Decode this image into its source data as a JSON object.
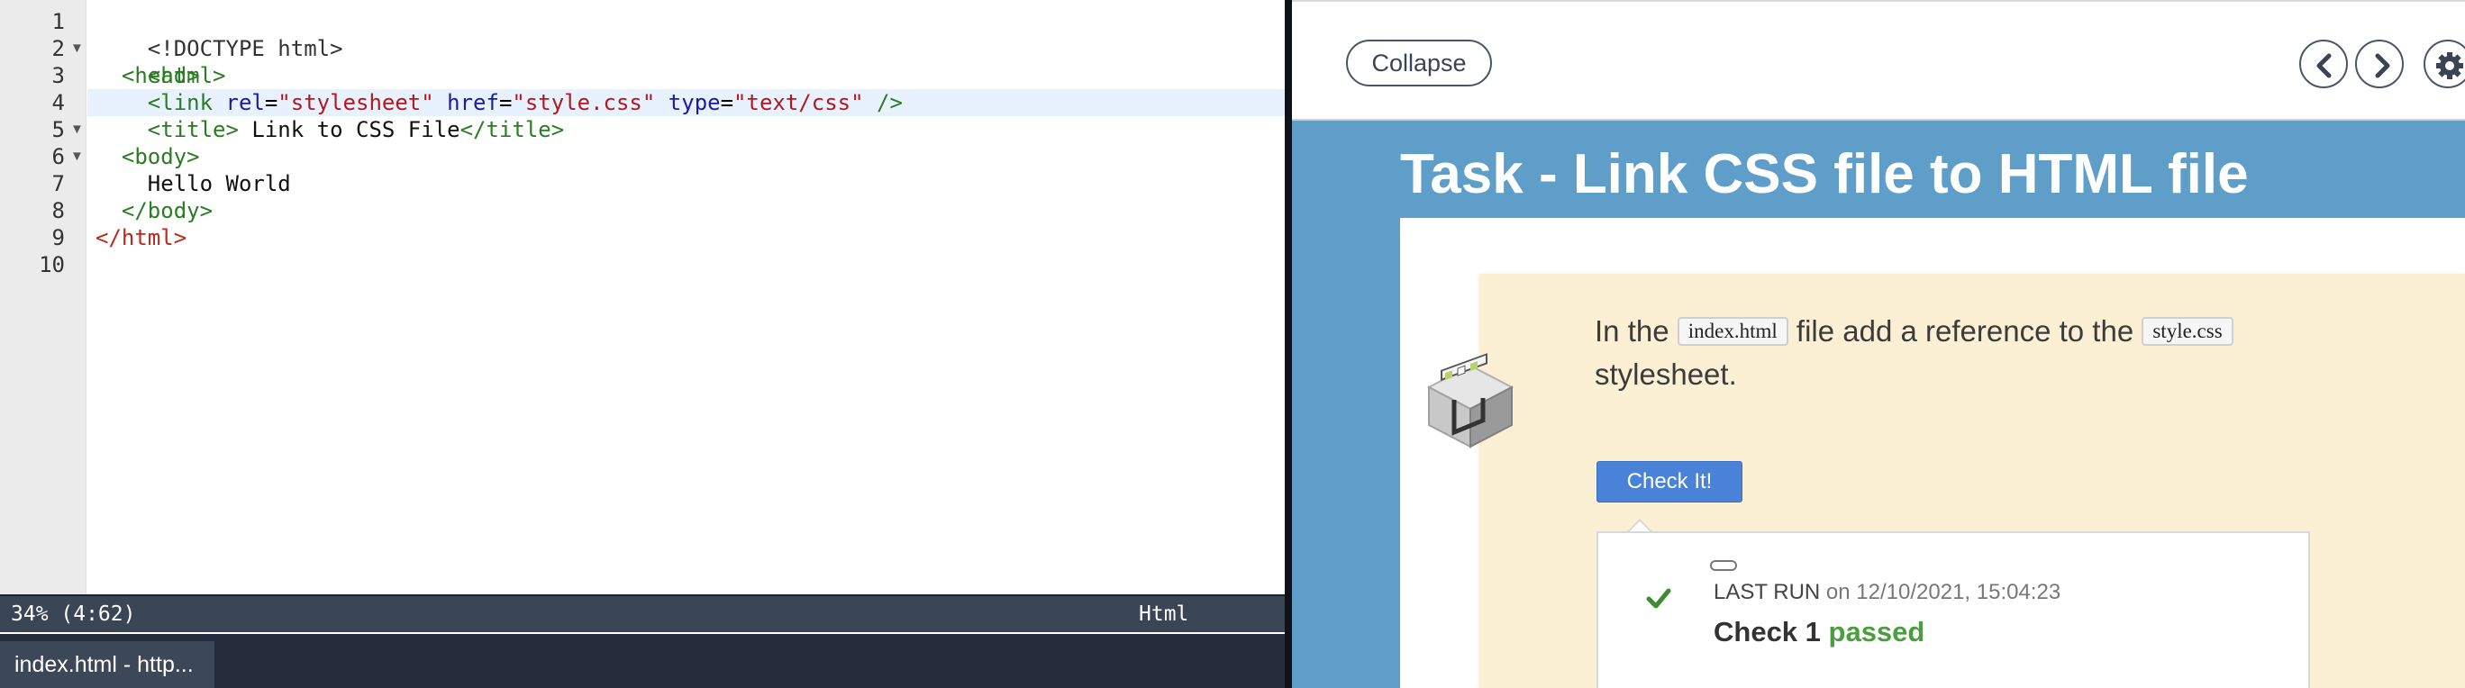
{
  "editor": {
    "line_numbers": [
      "1",
      "2",
      "3",
      "4",
      "5",
      "6",
      "7",
      "8",
      "9",
      "10"
    ],
    "fold_markers": {
      "line2": "▼",
      "line5": "▼",
      "line6": "▼"
    },
    "lines": {
      "l1": {
        "text": "<!DOCTYPE html>"
      },
      "l2": {
        "open": "<html>"
      },
      "l3": {
        "indent": "  ",
        "open": "<head>"
      },
      "l4": {
        "indent": "    ",
        "tag_open": "<link",
        "attr1": " rel",
        "eq": "=",
        "val1": "\"stylesheet\"",
        "attr2": " href",
        "val2": "\"style.css\"",
        "attr3": " type",
        "val3": "\"text/css\"",
        "close": " />"
      },
      "l5": {
        "indent": "    ",
        "open": "<title>",
        "text": " Link to CSS File",
        "close": "</title>"
      },
      "l6": {
        "indent": "  ",
        "open": "<body>"
      },
      "l7": {
        "indent": "    ",
        "text": "Hello World"
      },
      "l8": {
        "indent": "  ",
        "close": "</body>"
      },
      "l9": {
        "close": "</html>"
      },
      "l10": {
        "text": ""
      }
    },
    "status": {
      "position": "34%  (4:62)",
      "mode": "Html"
    },
    "tab": {
      "label": "index.html - http..."
    }
  },
  "task": {
    "collapse_label": "Collapse",
    "prev_icon": "chevron-left-icon",
    "next_icon": "chevron-right-icon",
    "settings_icon": "gear-icon",
    "title": "Task - Link CSS file to HTML file",
    "instruction": {
      "part1": "In the ",
      "code1": "index.html",
      "part2": " file add a reference to the ",
      "code2": "style.css",
      "part3": " stylesheet."
    },
    "check_button": "Check It!",
    "result": {
      "last_run_label": "LAST RUN",
      "on_word": " on ",
      "date": "12/10/2021, 15:04:23",
      "check_label": "Check 1 ",
      "check_status": "passed"
    }
  },
  "colors": {
    "task_header_bg": "#5e9ec9",
    "card_bg": "#fbf0d4",
    "check_button_bg": "#4a82d8",
    "passed_green": "#4a9e3f",
    "status_bar_bg": "#3a4556"
  }
}
